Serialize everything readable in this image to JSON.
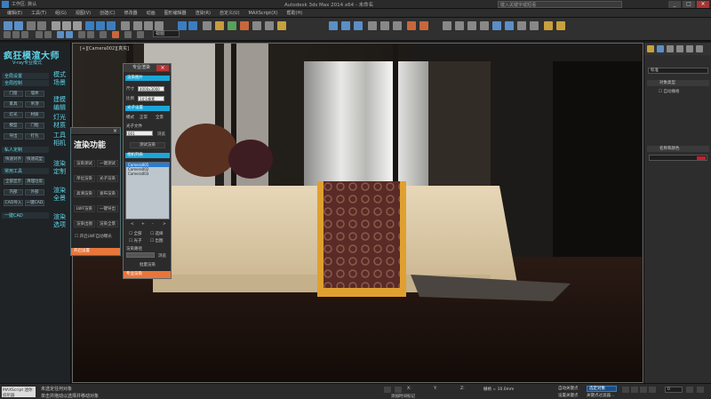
{
  "titlebar": {
    "menu": [
      "文件(F)",
      "编辑(E)",
      "工具(T)",
      "组(G)",
      "视图(V)",
      "创建(C)",
      "修改器",
      "动画",
      "图形编辑器",
      "渲染(R)",
      "自定义(U)",
      "MAXScript(X)",
      "帮助(H)"
    ],
    "title": "Autodesk 3ds Max 2014 x64 - 未命名",
    "search": "键入关键字或短语",
    "workspace": "工作区: 默认"
  },
  "menubar": [
    "编辑(E)",
    "工具(T)",
    "组(G)",
    "视图(V)",
    "创建(C)",
    "修改器",
    "动画",
    "图形编辑器",
    "渲染(R)",
    "自定义(U)",
    "MAXScript(X)",
    "帮助(H)"
  ],
  "toolbar": {
    "view_select": "视图"
  },
  "brand": {
    "title": "疯狂模渲大师",
    "subtitle": "V-ray专业模式",
    "sections": {
      "full": "全局设置",
      "all": "全局控制",
      "private": "私人定制",
      "common": "常用工具"
    },
    "buttons": [
      "门窗",
      "墙体",
      "家具",
      "吊顶",
      "灯光",
      "材质",
      "模型",
      "门框",
      "导出",
      "打包",
      "快速对齐",
      "快速成型",
      "全部显示",
      "清理垃圾",
      "内部",
      "外部",
      "CAD导入",
      "一键CAD"
    ],
    "one_cad": "一键CAD",
    "side": [
      "模式场景",
      "建模编辑",
      "灯光材质",
      "工具相机",
      "渲染定制",
      "渲染全景",
      "渲染选项"
    ]
  },
  "render_panel": {
    "title": "渲染功能",
    "close": "×",
    "buttons": [
      "渲染测试",
      "一键测试",
      "单位渲染",
      "光子渲染",
      "高清渲染",
      "发布渲染",
      "LWF渲染",
      "一键导出",
      "渲染出图",
      "渲染全景"
    ],
    "checkbox": "开启LWF自动曝光",
    "footer": "开启设置"
  },
  "pro_panel": {
    "title": "专业渲染",
    "close": "×",
    "section1": "渲染图片",
    "size_label": "尺寸",
    "size_value": "4000x3000",
    "ratio_label": "比例",
    "ratio_value": "1比1像素",
    "section2": "光子设置",
    "mode_label": "模式",
    "mode_a": "正常",
    "mode_b": "全景",
    "file_label": "光子文件",
    "file_value": "001",
    "browse": "浏览",
    "test": "测试渲染",
    "section3": "相机列表",
    "cameras": [
      "Camera001",
      "Camera002",
      "Camera003"
    ],
    "pager": [
      "<",
      "+",
      "-",
      ">"
    ],
    "check1": "全部",
    "check2": "选择",
    "check3": "光子",
    "check4": "出图",
    "out_label": "渲染路径",
    "out_browse": "浏览",
    "batch": "批量渲染",
    "footer": "专业渲染"
  },
  "viewport": {
    "label": "[+][Camera002][真实]"
  },
  "right_panel": {
    "dropdown": "标准",
    "roll1": "对象类型",
    "chk1": "自动栅格",
    "roll2": "名称和颜色"
  },
  "status": {
    "maxscript": "MAXScript 迷你侦听器",
    "msg1": "未选定任何对象",
    "msg2": "单击并拖动以选择并移动对象",
    "grid": "栅格 = 10.0mm",
    "autokey": "自动关键点",
    "key_select": "选定对象",
    "setkey": "设置关键点",
    "filter": "关键点过滤器...",
    "frame": "0",
    "add_tag": "添加时间标记"
  },
  "colors": {
    "accent": "#5ed5ea",
    "orange": "#e8763a",
    "blue": "#1ba6d8"
  }
}
